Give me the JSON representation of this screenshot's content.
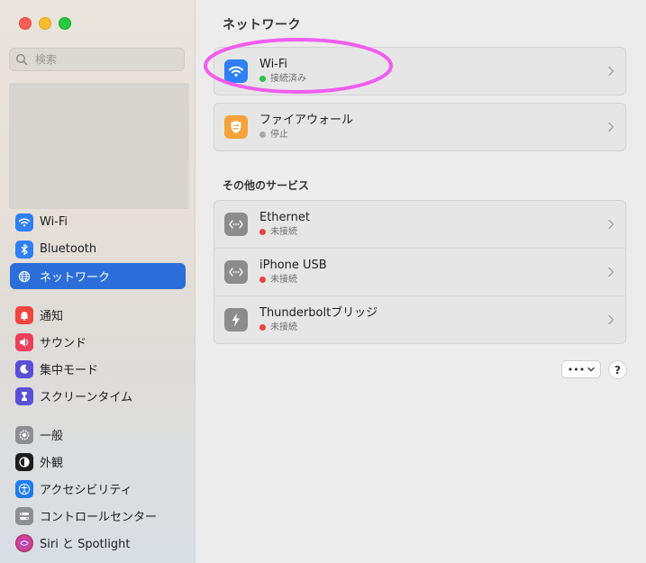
{
  "search": {
    "placeholder": "検索"
  },
  "sidebar": {
    "items": [
      {
        "label": "Wi-Fi",
        "icon": "wifi-icon",
        "color": "#2f7ff6",
        "active": false
      },
      {
        "label": "Bluetooth",
        "icon": "bluetooth-icon",
        "color": "#2f7ff6",
        "active": false
      },
      {
        "label": "ネットワーク",
        "icon": "globe-icon",
        "color": "#2c6ed9",
        "active": true
      },
      {
        "label": "通知",
        "icon": "bell-icon",
        "color": "#f2453d",
        "active": false
      },
      {
        "label": "サウンド",
        "icon": "speaker-icon",
        "color": "#ec3f5c",
        "active": false
      },
      {
        "label": "集中モード",
        "icon": "moon-icon",
        "color": "#5a4fd6",
        "active": false
      },
      {
        "label": "スクリーンタイム",
        "icon": "hourglass-icon",
        "color": "#5a4fd6",
        "active": false
      },
      {
        "label": "一般",
        "icon": "gear-icon",
        "color": "#8e8e93",
        "active": false
      },
      {
        "label": "外観",
        "icon": "appearance-icon",
        "color": "#1d1d1f",
        "active": false
      },
      {
        "label": "アクセシビリティ",
        "icon": "accessibility-icon",
        "color": "#1f7cf0",
        "active": false
      },
      {
        "label": "コントロールセンター",
        "icon": "control-center-icon",
        "color": "#8e8e93",
        "active": false
      },
      {
        "label": "Siri と Spotlight",
        "icon": "siri-icon",
        "color": "#222",
        "active": false
      }
    ]
  },
  "main": {
    "title": "ネットワーク",
    "primary": [
      {
        "title": "Wi-Fi",
        "status": "接続済み",
        "status_color": "#2fbf4b",
        "icon": "wifi-icon",
        "icon_color": "#2f7ff6"
      },
      {
        "title": "ファイアウォール",
        "status": "停止",
        "status_color": "#a8a8a8",
        "icon": "firewall-icon",
        "icon_color": "#f6a23a"
      }
    ],
    "services_title": "その他のサービス",
    "services": [
      {
        "title": "Ethernet",
        "status": "未接続",
        "status_color": "#e8453c",
        "icon": "ethernet-icon"
      },
      {
        "title": "iPhone USB",
        "status": "未接続",
        "status_color": "#e8453c",
        "icon": "ethernet-icon"
      },
      {
        "title": "Thunderboltブリッジ",
        "status": "未接続",
        "status_color": "#e8453c",
        "icon": "thunderbolt-icon"
      }
    ],
    "more_button": "•••",
    "help_button": "?"
  },
  "annotation": {
    "color": "#f15df0"
  }
}
